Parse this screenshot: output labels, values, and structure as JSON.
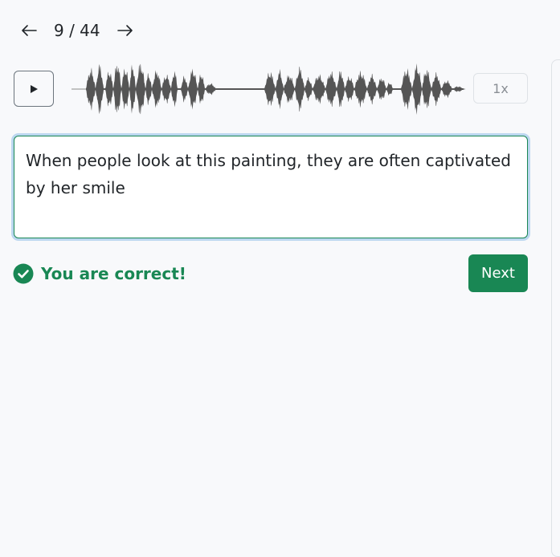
{
  "navigation": {
    "prev_icon": "arrow-left-icon",
    "counter": "9 / 44",
    "next_icon": "arrow-right-icon"
  },
  "player": {
    "play_icon": "play-icon",
    "speed_label": "1x"
  },
  "answer": {
    "text": "When people look at this painting, they are often captivated by her smile"
  },
  "result": {
    "icon": "check-circle-icon",
    "message": "You are correct!",
    "color": "#198754"
  },
  "actions": {
    "next_label": "Next"
  },
  "colors": {
    "accent": "#198754",
    "waveform": "#555555",
    "focus_ring": "#bcd7f0"
  }
}
